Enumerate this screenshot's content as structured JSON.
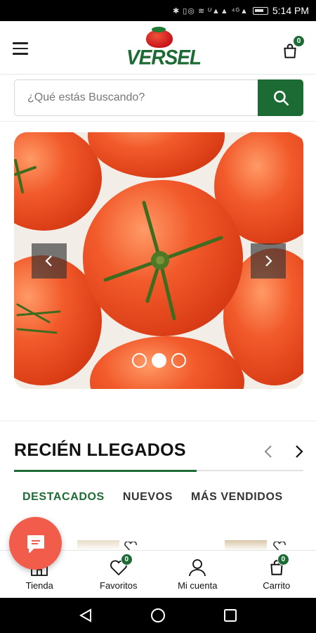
{
  "status_bar": {
    "time": "5:14 PM",
    "icons_text": "✱ ▯◎ ≋ ᵁ▲▲ ⁴ᴳ▲"
  },
  "header": {
    "logo_text": "VERSEL",
    "cart_count": "0"
  },
  "search": {
    "placeholder": "¿Qué estás Buscando?"
  },
  "banner": {
    "slide_count": 3,
    "active_slide": 2
  },
  "section": {
    "title": "RECIÉN LLEGADOS",
    "tabs": [
      {
        "label": "DESTACADOS",
        "active": true
      },
      {
        "label": "NUEVOS",
        "active": false
      },
      {
        "label": "MÁS VENDIDOS",
        "active": false
      }
    ]
  },
  "bottom_nav": {
    "items": [
      {
        "label": "Tienda",
        "icon": "store-icon"
      },
      {
        "label": "Favoritos",
        "icon": "heart-icon",
        "badge": "0"
      },
      {
        "label": "Mi cuenta",
        "icon": "user-icon"
      },
      {
        "label": "Carrito",
        "icon": "cart-icon",
        "badge": "0"
      }
    ]
  },
  "colors": {
    "brand_green": "#1d6b34",
    "fab_red": "#f25c4a"
  }
}
